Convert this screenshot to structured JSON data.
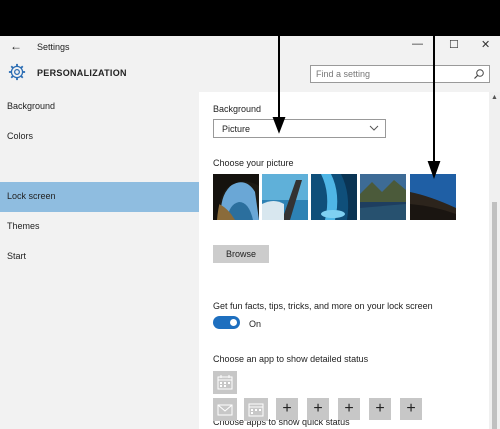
{
  "window": {
    "app_title": "Settings",
    "back_glyph": "←",
    "minimize_glyph": "—",
    "maximize_glyph": "☐",
    "close_glyph": "✕"
  },
  "header": {
    "section_title": "PERSONALIZATION",
    "search_placeholder": "Find a setting"
  },
  "sidebar": {
    "items": [
      {
        "label": "Background"
      },
      {
        "label": "Colors"
      },
      {
        "label": "Lock screen"
      },
      {
        "label": "Themes"
      },
      {
        "label": "Start"
      }
    ],
    "active_index": 2,
    "active_color": "#8fbde0"
  },
  "main": {
    "background_label": "Background",
    "background_value": "Picture",
    "choose_picture_label": "Choose your picture",
    "browse_label": "Browse",
    "fun_facts_label": "Get fun facts, tips, tricks, and more on your lock screen",
    "toggle_state": "On",
    "detailed_status_label": "Choose an app to show detailed status",
    "quick_status_label": "Choose apps to show quick status",
    "plus_glyph": "+"
  },
  "colors": {
    "accent": "#1e6fbf",
    "chrome": "#f2f2f2",
    "tile": "#c7c7c7"
  }
}
